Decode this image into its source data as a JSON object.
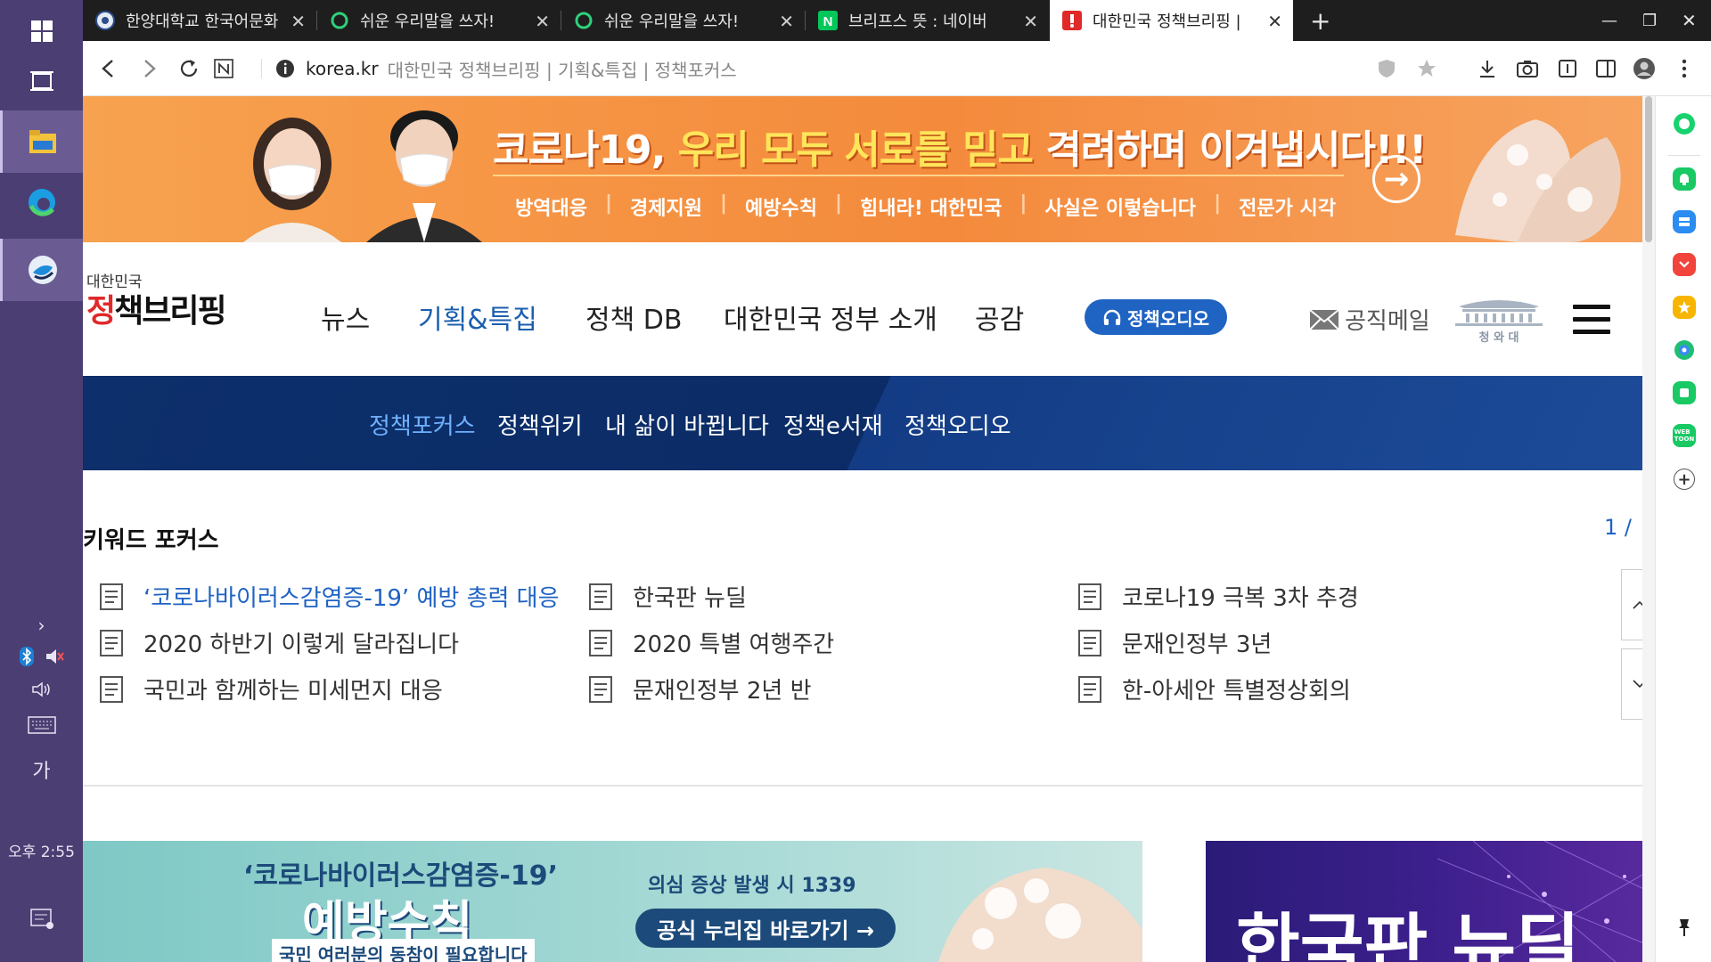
{
  "taskbar": {
    "clock": "오후 2:55",
    "ime": "가",
    "show_hidden": "›"
  },
  "browser": {
    "tabs": [
      {
        "title": "한양대학교 한국어문화",
        "active": false
      },
      {
        "title": "쉬운 우리말을 쓰자!",
        "active": false
      },
      {
        "title": "쉬운 우리말을 쓰자!",
        "active": false
      },
      {
        "title": "브리프스 뜻 : 네이버",
        "active": false
      },
      {
        "title": "대한민국 정책브리핑 |",
        "active": true
      }
    ],
    "new_tab": "+",
    "url_domain": "korea.kr",
    "url_path": "대한민국 정책브리핑 | 기획&특집 | 정책포커스"
  },
  "banner": {
    "title_pre": "코로나19, ",
    "title_highlight": "우리 모두 서로를 믿고 ",
    "title_post": "격려하며 이겨냅시다!!!",
    "links": [
      "방역대응",
      "경제지원",
      "예방수칙",
      "힘내라! 대한민국",
      "사실은 이렇습니다",
      "전문가 시각"
    ]
  },
  "header": {
    "logo_small": "대한민국",
    "logo_big_a": "정",
    "logo_big_b": "책브리핑",
    "nav": [
      "뉴스",
      "기획&특집",
      "정책 DB",
      "대한민국 정부 소개",
      "공감"
    ],
    "audio_button": "정책오디오",
    "mail": "공직메일",
    "bluehouse": "청 와 대"
  },
  "subnav": [
    "정책포커스",
    "정책위키",
    "내 삶이 바뀝니다",
    "정책e서재",
    "정책오디오"
  ],
  "keywords": {
    "title": "키워드 포커스",
    "page_indicator": "1 /",
    "items": [
      "‘코로나바이러스감염증-19’ 예방 총력 대응",
      "2020 하반기 이렇게 달라집니다",
      "국민과 함께하는 미세먼지 대응",
      "한국판 뉴딜",
      "2020 특별 여행주간",
      "문재인정부 2년 반",
      "코로나19 극복 3차 추경",
      "문재인정부 3년",
      "한-아세안 특별정상회의"
    ]
  },
  "cards": {
    "card1_title": "‘코로나바이러스감염증-19’",
    "card1_main": "예방수칙",
    "card1_sub": "국민 여러분의 동참이 필요합니다",
    "card1_hotline": "의심 증상 발생 시 1339",
    "card1_button": "공식 누리집 바로가기 →",
    "card2_title": "한국판 뉴딜"
  },
  "colors": {
    "accent_blue": "#1f63c3",
    "nav_dark": "#0d2f6b",
    "banner_orange": "#f48a3c"
  }
}
